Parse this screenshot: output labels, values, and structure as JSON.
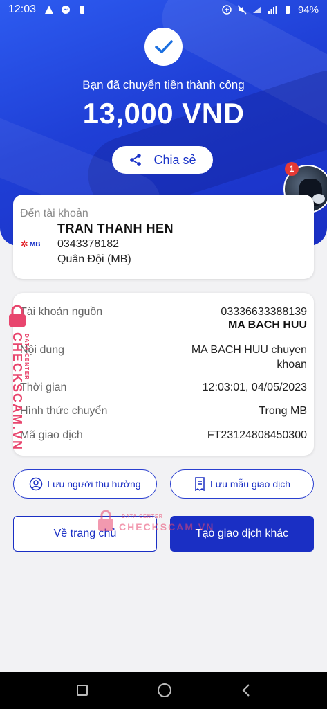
{
  "status_bar": {
    "time": "12:03",
    "network": "4G",
    "battery": "94%"
  },
  "hero": {
    "success_message": "Bạn đã chuyển tiền thành công",
    "amount": "13,000 VND",
    "share_label": "Chia sẻ",
    "notification_count": "1"
  },
  "destination": {
    "label": "Đến tài khoản",
    "bank_logo_text": "MB",
    "name": "TRAN THANH HEN",
    "account_number": "0343378182",
    "bank_name": "Quân Đội (MB)"
  },
  "details": {
    "source_account_label": "Tài khoản nguồn",
    "source_account_number": "03336633388139",
    "source_account_name": "MA BACH HUU",
    "content_label": "Nội dung",
    "content_line1": "MA BACH HUU chuyen",
    "content_line2": "khoan",
    "time_label": "Thời gian",
    "time_value": "12:03:01, 04/05/2023",
    "method_label": "Hình thức chuyển",
    "method_value": "Trong MB",
    "tx_code_label": "Mã giao dịch",
    "tx_code_value": "FT23124808450300"
  },
  "actions": {
    "save_beneficiary": "Lưu người thụ hưởng",
    "save_template": "Lưu mẫu giao dịch",
    "go_home": "Về trang chủ",
    "new_transaction": "Tạo giao dịch khác"
  },
  "watermark": {
    "brand": "CHECKSCAM.VN",
    "sub": "DATA CENTER"
  },
  "colors": {
    "primary": "#1a2fc4",
    "watermark": "#e8466e"
  }
}
